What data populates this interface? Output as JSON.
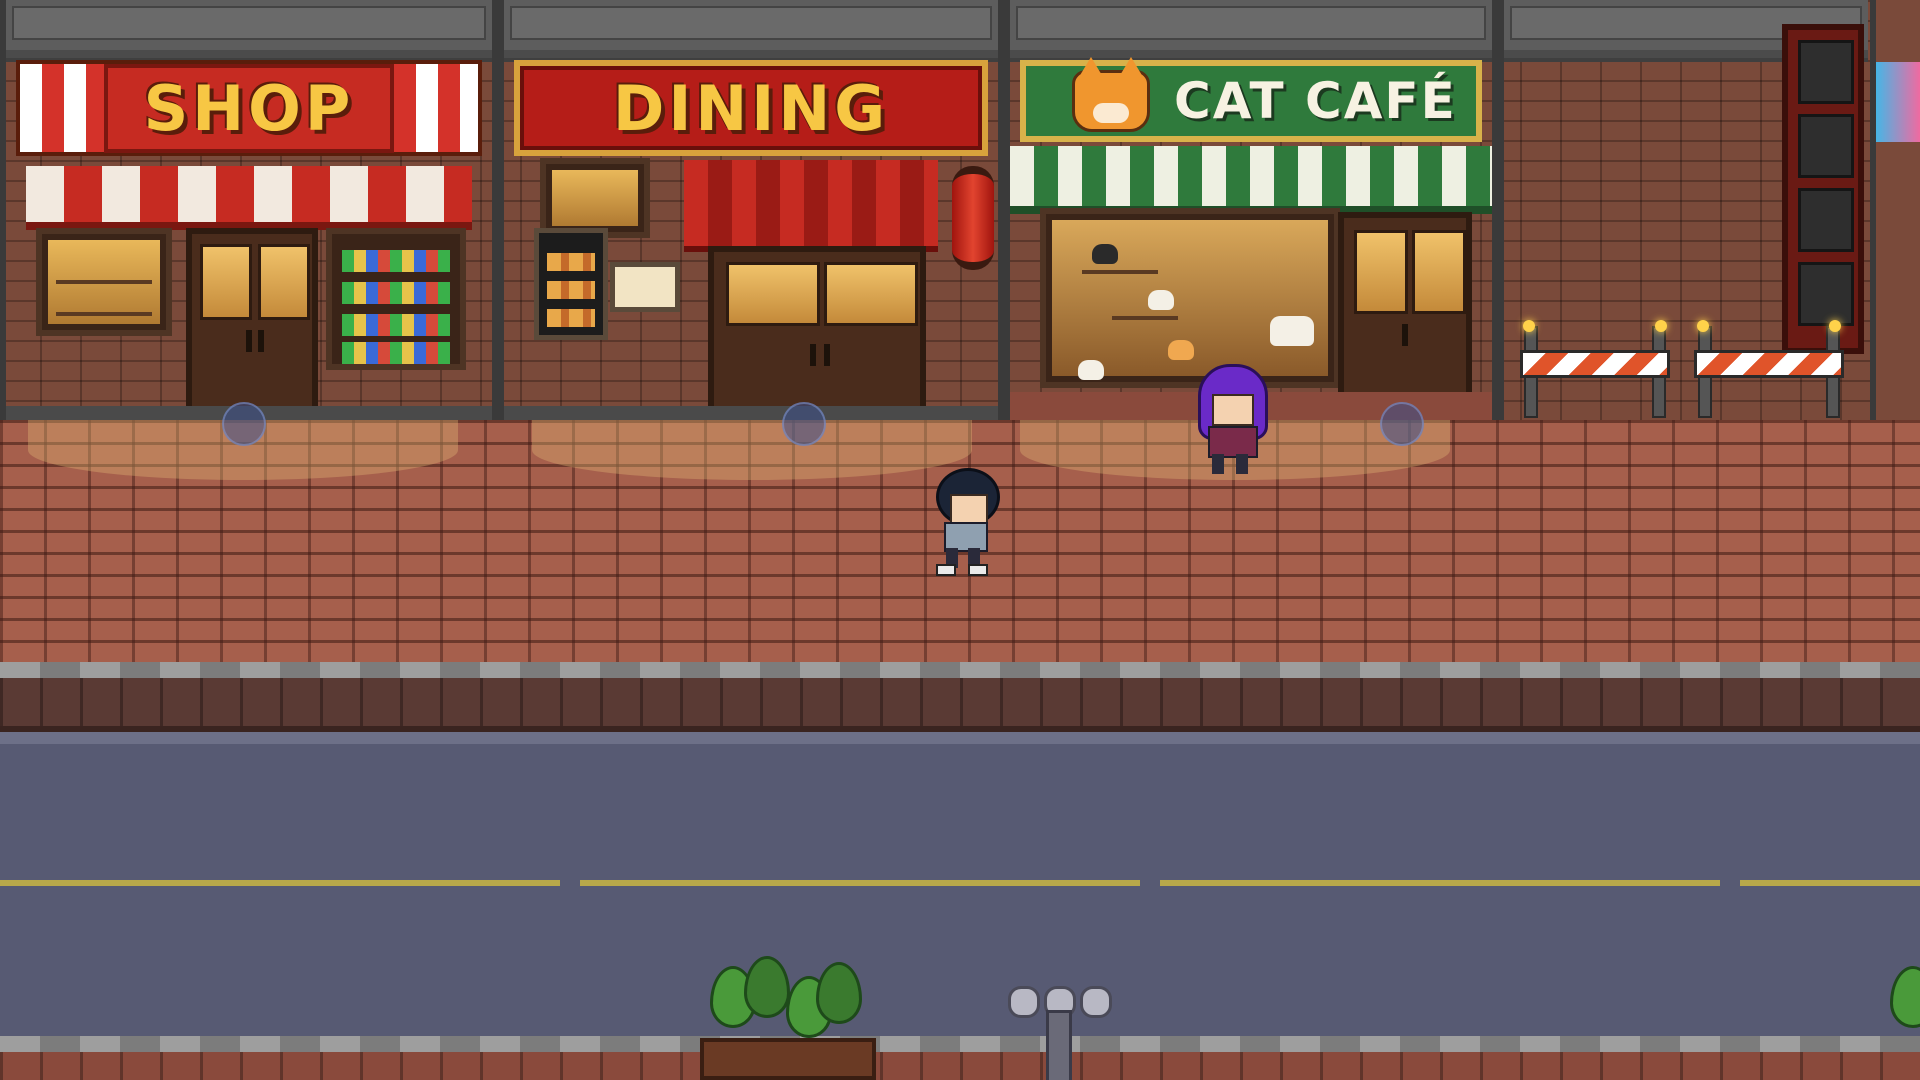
{
  "scene": {
    "type": "pixel-art street, side-scrolling view"
  },
  "storefronts": [
    {
      "name": "shop",
      "sign_text": "SHOP",
      "colors": {
        "sign": "#c62b22",
        "text": "#f7c744"
      }
    },
    {
      "name": "dining",
      "sign_text": "DINING",
      "colors": {
        "sign": "#b51d18",
        "text": "#f7c744"
      }
    },
    {
      "name": "cat-cafe",
      "sign_text": "CAT CAFÉ",
      "colors": {
        "sign": "#2f7a3c",
        "text": "#f7f2e2"
      }
    }
  ],
  "interactables": {
    "entrance_markers": [
      "shop-entrance",
      "dining-entrance",
      "cat-cafe-entrance"
    ]
  },
  "characters": [
    {
      "role": "player",
      "hair_color": "#1b2436",
      "outfit_color": "#8fa0b0"
    },
    {
      "role": "npc",
      "hair_color": "#6a2ac8",
      "outfit_color": "#7a2a4a"
    }
  ],
  "colors": {
    "sidewalk": "#a65f4c",
    "road": "#575a73",
    "lane_line": "#b8a84a"
  }
}
